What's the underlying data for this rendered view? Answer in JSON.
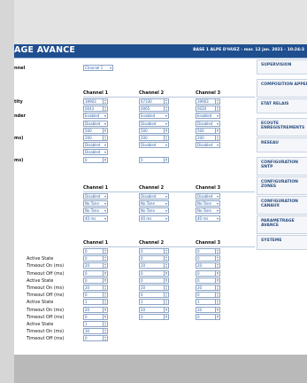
{
  "header": {
    "title": "AGE AVANCE",
    "info": "BASE 1 ALPE D'HUEZ - mar. 12 jan. 2021 - 10:24:3"
  },
  "section1": {
    "top_label": "nnel",
    "top_select": "Channel 1",
    "columns": [
      "Channel 1",
      "Channel 2",
      "Channel 3"
    ],
    "rows": [
      {
        "label": "tity",
        "values": [
          "39903",
          "67330",
          "39903"
        ]
      },
      {
        "label": "",
        "values": [
          "0043",
          "0065",
          "0020"
        ]
      },
      {
        "label": "nder",
        "values": [
          "Enabled",
          "Enabled",
          "Enabled"
        ]
      },
      {
        "label": "",
        "values": [
          "Disabled",
          "Disabled",
          "Disabled"
        ]
      },
      {
        "label": "",
        "values": [
          "500",
          "500",
          "500"
        ]
      },
      {
        "label": "ms)",
        "values": [
          "200",
          "200",
          "200"
        ]
      },
      {
        "label": "",
        "values": [
          "Disabled",
          "Disabled",
          "Disabled"
        ]
      },
      {
        "label": "",
        "values": [
          "Disabled",
          "",
          ""
        ]
      },
      {
        "label": "ms)",
        "values": [
          "0",
          "0",
          ""
        ]
      }
    ]
  },
  "section2": {
    "columns": [
      "Channel 1",
      "Channel 2",
      "Channel 3"
    ],
    "rows": [
      {
        "values": [
          "Disabled",
          "Disabled",
          "Disabled"
        ]
      },
      {
        "values": [
          "No Tone",
          "No Tone",
          "No Tone"
        ]
      },
      {
        "values": [
          "No Tone",
          "No Tone",
          "No Tone"
        ]
      },
      {
        "values": [
          "40 ms",
          "40 ms",
          "40 ms"
        ]
      }
    ]
  },
  "section3": {
    "columns": [
      "Channel 1",
      "Channel 2",
      "Channel 3"
    ],
    "rows": [
      {
        "label": "",
        "values": [
          "0",
          "0",
          "0"
        ]
      },
      {
        "label": "Active State",
        "values": [
          "0",
          "0",
          "0"
        ]
      },
      {
        "label": "Timeout On (ms)",
        "values": [
          "20",
          "20",
          "20"
        ]
      },
      {
        "label": "Timeout Off (ms)",
        "values": [
          "0",
          "0",
          "0"
        ]
      },
      {
        "label": "Active State",
        "values": [
          "0",
          "0",
          "0"
        ]
      },
      {
        "label": "Timeout On (ms)",
        "values": [
          "20",
          "20",
          "20"
        ]
      },
      {
        "label": "Timeout Off (ms)",
        "values": [
          "0",
          "0",
          "0"
        ]
      },
      {
        "label": "Active State",
        "values": [
          "1",
          "1",
          "1"
        ]
      },
      {
        "label": "Timeout On (ms)",
        "values": [
          "20",
          "20",
          "20"
        ]
      },
      {
        "label": "Timeout Off (ms)",
        "values": [
          "0",
          "0",
          "0"
        ]
      },
      {
        "label": "Active State",
        "values": [
          "1",
          "",
          ""
        ]
      },
      {
        "label": "Timeout On (ms)",
        "values": [
          "30",
          "",
          ""
        ]
      },
      {
        "label": "Timeout Off (ms)",
        "values": [
          "0",
          "",
          ""
        ]
      }
    ]
  },
  "sidebar": {
    "items": [
      {
        "label": "SUPERVISION"
      },
      {
        "label": "COMPOSITION APPEL"
      },
      {
        "label": "ETAT RELAIS"
      },
      {
        "label": "ECOUTE ENREGISTREMENTS"
      },
      {
        "label": "RESEAU"
      },
      {
        "label": "CONFIGURATION SNTP"
      },
      {
        "label": "CONFIGURATION ZONES"
      },
      {
        "label": "CONFIGURATION CANAUX"
      },
      {
        "label": "PARAMETRAGE AVANCE"
      },
      {
        "label": "SYSTEME"
      }
    ]
  },
  "colors": {
    "header": "#1f4f8f",
    "accent": "#2b5fa8",
    "border": "#8aa3c4"
  }
}
